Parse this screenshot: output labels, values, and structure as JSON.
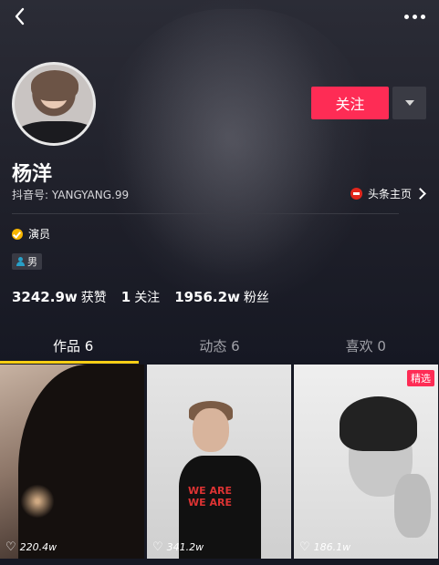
{
  "profile": {
    "name": "杨洋",
    "douyin_id": "抖音号: YANGYANG.99",
    "toutiao_link": "头条主页",
    "verification": "演员",
    "gender": "男"
  },
  "actions": {
    "follow_label": "关注"
  },
  "stats": {
    "likes_num": "3242.9w",
    "likes_label": "获赞",
    "following_num": "1",
    "following_label": "关注",
    "fans_num": "1956.2w",
    "fans_label": "粉丝"
  },
  "tabs": [
    {
      "label": "作品 6",
      "active": true
    },
    {
      "label": "动态 6",
      "active": false
    },
    {
      "label": "喜欢 0",
      "active": false
    }
  ],
  "videos": [
    {
      "likes": "220.4w"
    },
    {
      "likes": "341.2w",
      "shirt_text": "WE ARE WE ARE"
    },
    {
      "likes": "186.1w",
      "tag": "精选"
    }
  ],
  "icons": {
    "back": "back-arrow-icon",
    "more": "more-dots-icon",
    "dropdown": "caret-down-icon",
    "heart": "heart-icon"
  },
  "colors": {
    "accent": "#fe2c55",
    "tab_indicator": "#face15",
    "background": "#161823"
  }
}
